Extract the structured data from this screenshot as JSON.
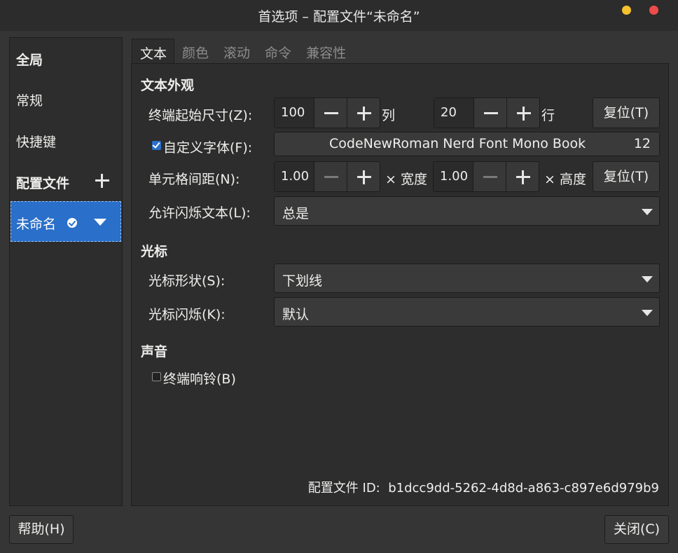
{
  "window": {
    "title": "首选项 – 配置文件“未命名”"
  },
  "sidebar": {
    "global_heading": "全局",
    "items": [
      {
        "label": "常规"
      },
      {
        "label": "快捷键"
      }
    ],
    "profiles_heading": "配置文件",
    "profiles": [
      {
        "label": "未命名",
        "selected": true
      }
    ]
  },
  "tabs": [
    {
      "label": "文本",
      "active": true
    },
    {
      "label": "颜色",
      "active": false
    },
    {
      "label": "滚动",
      "active": false
    },
    {
      "label": "命令",
      "active": false
    },
    {
      "label": "兼容性",
      "active": false
    }
  ],
  "text_tab": {
    "appearance_heading": "文本外观",
    "initial_size_label": "终端起始尺寸(Z):",
    "columns_value": "100",
    "columns_unit": "列",
    "rows_value": "20",
    "rows_unit": "行",
    "reset_size_label": "复位(T)",
    "custom_font_label": "自定义字体(F):",
    "custom_font_checked": true,
    "font_name": "CodeNewRoman Nerd Font Mono Book",
    "font_size": "12",
    "cell_spacing_label": "单元格间距(N):",
    "width_value": "1.00",
    "width_unit": "× 宽度",
    "height_value": "1.00",
    "height_unit": "× 高度",
    "reset_spacing_label": "复位(T)",
    "blink_text_label": "允许闪烁文本(L):",
    "blink_text_value": "总是",
    "cursor_heading": "光标",
    "cursor_shape_label": "光标形状(S):",
    "cursor_shape_value": "下划线",
    "cursor_blink_label": "光标闪烁(K):",
    "cursor_blink_value": "默认",
    "sound_heading": "声音",
    "bell_label": "终端响铃(B)",
    "bell_checked": false,
    "profile_id_label": "配置文件 ID:",
    "profile_id_value": "b1dcc9dd-5262-4d8d-a863-c897e6d979b9"
  },
  "footer": {
    "help_label": "帮助(H)",
    "close_label": "关闭(C)"
  }
}
